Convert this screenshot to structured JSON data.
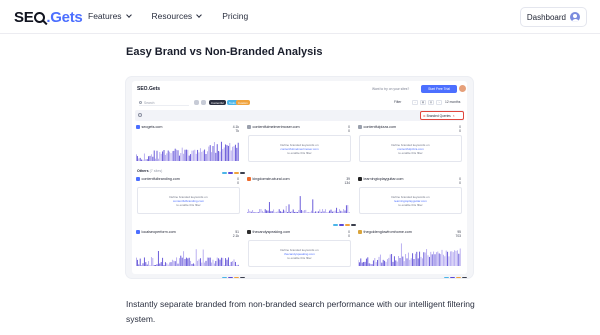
{
  "nav": {
    "logo_a": "SE",
    "logo_b": ".Gets",
    "links": [
      "Features",
      "Resources",
      "Pricing"
    ],
    "dashboard": "Dashboard"
  },
  "heading": "Easy Brand vs Non-Branded Analysis",
  "app": {
    "logo": "SEO.Gets",
    "how": "Want to try on your sites?",
    "trial": "Start Free Trial",
    "search_placeholder": "Search",
    "tags": [
      "Contentful",
      "Tools",
      "Custom"
    ],
    "filter": "Filter",
    "months": "12 months",
    "branded_label": "Branded Queries",
    "others_label": "Others",
    "others_sub": "(7 sites)",
    "empty_msg": [
      "Define branded keywords on",
      "to enable this filter"
    ],
    "cards": [
      {
        "site": "seogets.com",
        "stat1": "4.1k",
        "stat2": "7k",
        "kind": "chart",
        "fav": "#4c6fff"
      },
      {
        "site": "contentfulmelmerimoser.com",
        "stat1": "0",
        "stat2": "0",
        "kind": "empty",
        "domain": "contentfulmelmerimoser.com",
        "fav": "#9aa0ad"
      },
      {
        "site": "contentfulpizza.com",
        "stat1": "0",
        "stat2": "0",
        "kind": "empty",
        "domain": "contentfulpizza.com",
        "fav": "#9aa0ad"
      },
      {
        "site": "contentfulbranding.com",
        "stat1": "0",
        "stat2": "0",
        "kind": "empty",
        "domain": "contentfulbranding.com",
        "fav": "#4c6fff"
      },
      {
        "site": "kingdomstructural.com",
        "stat1": "39",
        "stat2": "134",
        "kind": "chart",
        "fav": "#ee6b2b"
      },
      {
        "site": "learningtoplayguitar.com",
        "stat1": "0",
        "stat2": "0",
        "kind": "empty",
        "domain": "learningtoplayguitar.com",
        "fav": "#222"
      },
      {
        "site": "localseoperform.com",
        "stat1": "51",
        "stat2": "2.1k",
        "kind": "chart",
        "fav": "#4c6fff"
      },
      {
        "site": "thecandyspeaking.com",
        "stat1": "0",
        "stat2": "0",
        "kind": "empty",
        "domain": "thecandyspeaking.com",
        "fav": "#2d2d2d"
      },
      {
        "site": "thegoldenglowfromhome.com",
        "stat1": "95",
        "stat2": "703",
        "kind": "chart",
        "fav": "#d9a43b"
      }
    ]
  },
  "caption": "Instantly separate branded from non-branded search performance with our intelligent filtering system.",
  "colors": {
    "accent": "#4c6fff",
    "spark_a": "#5b4bd6",
    "spark_b": "#b3a8ef",
    "highlight": "#e0463d"
  }
}
